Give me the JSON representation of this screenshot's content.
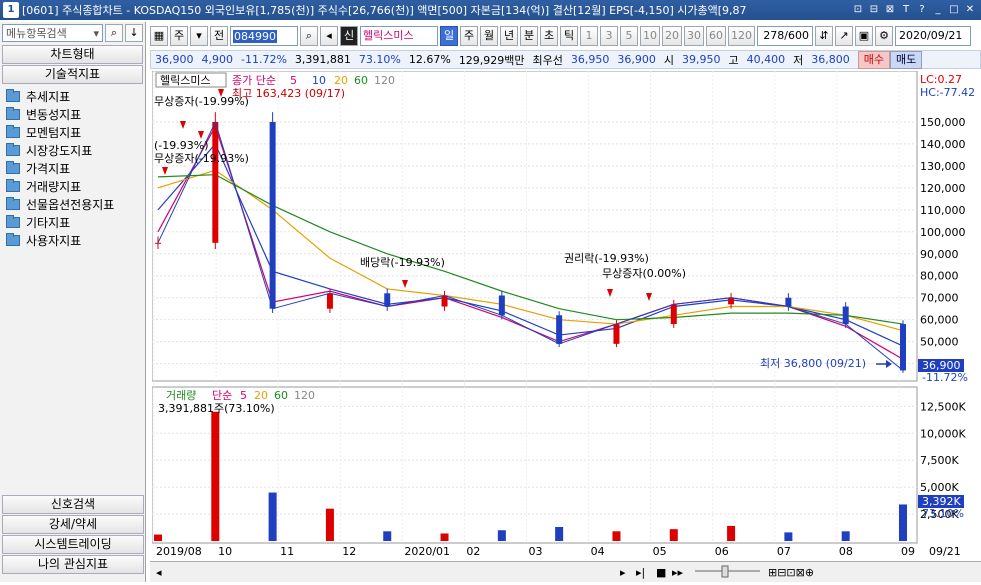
{
  "window": {
    "badge": "1",
    "title": "[0601] 주식종합차트 - KOSDAQ150 외국인보유[1,785(천)] 주식수[26,766(천)] 액면[500] 자본금[134(억)] 결산[12월] EPS[-4,150] 시가총액[9,87",
    "buttons": [
      "⊡",
      "⊟",
      "⊠",
      "T",
      "?",
      "_",
      "□",
      "✕"
    ]
  },
  "left": {
    "search_placeholder": "메뉴항목검색",
    "tabs": [
      "차트형태",
      "기술적지표"
    ],
    "tree": [
      "추세지표",
      "변동성지표",
      "모멘텀지표",
      "시장강도지표",
      "가격지표",
      "거래량지표",
      "선물옵션전용지표",
      "기타지표",
      "사용자지표"
    ],
    "bottom_buttons": [
      "신호검색",
      "강세/약세",
      "시스템트레이딩",
      "나의 관심지표"
    ]
  },
  "toolbar": {
    "type": "주",
    "prefix": "전",
    "code": "084990",
    "stock_badge": "신",
    "stock_name": "헬릭스미스",
    "periods": [
      "일",
      "주",
      "월",
      "년",
      "분",
      "초",
      "틱"
    ],
    "selected_period": "일",
    "intervals": [
      "1",
      "3",
      "5",
      "10",
      "20",
      "30",
      "60",
      "120"
    ],
    "count": "278/600",
    "date": "2020/09/21"
  },
  "info": {
    "price": "36,900",
    "change": "4,900",
    "change_pct": "-11.72%",
    "volume": "3,391,881",
    "vol_ratio": "73.10%",
    "turnover": "12.67%",
    "amount": "129,929백만",
    "best_label": "최우선",
    "ask": "36,950",
    "bid": "36,900",
    "open_label": "시",
    "open": "39,950",
    "high_label": "고",
    "high": "40,400",
    "low_label": "저",
    "low": "36,800",
    "buy": "매수",
    "sell": "매도"
  },
  "price_panel": {
    "stock": "헬릭스미스",
    "legend_ma": "종가 단순",
    "ma_periods": [
      "5",
      "10",
      "20",
      "60",
      "120"
    ],
    "ma_colors": [
      "#d6006c",
      "#1f3fbf",
      "#e6a000",
      "#1f8a1f",
      "#888888"
    ],
    "lc": "LC:0.27",
    "hc": "HC:-77.42",
    "yticks": [
      "150,000",
      "140,000",
      "130,000",
      "120,000",
      "110,000",
      "100,000",
      "90,000",
      "80,000",
      "70,000",
      "60,000",
      "50,000",
      "40,000"
    ],
    "current_price_tag": "36,900",
    "current_pct": "-11.72%",
    "annotations": {
      "high": "최고 163,423 (09/17)",
      "low": "최저 36,800 (09/21)",
      "ex_div": "배당락(-19.93%)",
      "ex_right": "권리락(-19.93%)",
      "bonus_zero": "무상증자(0.00%)",
      "bonus1": "무상증자(-19.93%)",
      "bonus2": "무상증자(-19.99%)",
      "bonus3": "(-19.93%)"
    }
  },
  "volume_panel": {
    "legend": "거래량",
    "legend_ma": "단순",
    "ma_periods": [
      "5",
      "20",
      "60",
      "120"
    ],
    "value_label": "3,391,881주(73.10%)",
    "yticks": [
      "12,500K",
      "10,000K",
      "7,500K",
      "5,000K",
      "2,500K"
    ],
    "current_tag": "3,392K",
    "current_pct": "73.10%"
  },
  "xaxis": [
    "2019/08",
    "10",
    "11",
    "12",
    "2020/01",
    "02",
    "03",
    "04",
    "05",
    "06",
    "07",
    "08",
    "09",
    "09/21"
  ],
  "chart_data": [
    {
      "type": "candlestick",
      "title": "헬릭스미스",
      "ylim": [
        33000,
        165000
      ],
      "x": [
        "2019/08",
        "2019/09",
        "2019/10",
        "2019/11",
        "2019/12",
        "2020/01",
        "2020/02",
        "2020/03",
        "2020/04",
        "2020/05",
        "2020/06",
        "2020/07",
        "2020/08",
        "2020/09/21"
      ],
      "series": [
        {
          "name": "종가",
          "values": [
            95000,
            150000,
            65000,
            72000,
            66000,
            71000,
            62000,
            49000,
            58000,
            67000,
            70000,
            66000,
            58000,
            36900
          ]
        },
        {
          "name": "5",
          "values": [
            100000,
            148000,
            68000,
            73000,
            66000,
            70000,
            61000,
            50000,
            58000,
            67000,
            70000,
            66000,
            57000,
            42000
          ]
        },
        {
          "name": "20",
          "values": [
            110000,
            140000,
            82000,
            74000,
            67000,
            70000,
            64000,
            53000,
            56000,
            66000,
            69000,
            66000,
            60000,
            48000
          ]
        },
        {
          "name": "60",
          "values": [
            120000,
            128000,
            110000,
            88000,
            74000,
            71000,
            67000,
            60000,
            58000,
            62000,
            66000,
            66000,
            62000,
            55000
          ]
        },
        {
          "name": "120",
          "values": [
            125000,
            126000,
            112000,
            100000,
            90000,
            82000,
            73000,
            65000,
            60000,
            61000,
            63000,
            63000,
            62000,
            58000
          ]
        }
      ],
      "high": 163423,
      "high_date": "09/17",
      "low": 36800,
      "low_date": "09/21"
    },
    {
      "type": "bar",
      "title": "거래량",
      "ylim": [
        0,
        13000000
      ],
      "x": [
        "2019/08",
        "2019/09",
        "2019/10",
        "2019/11",
        "2019/12",
        "2020/01",
        "2020/02",
        "2020/03",
        "2020/04",
        "2020/05",
        "2020/06",
        "2020/07",
        "2020/08",
        "2020/09/21"
      ],
      "values": [
        600000,
        12000000,
        4500000,
        3000000,
        900000,
        700000,
        1000000,
        1300000,
        900000,
        1100000,
        1400000,
        800000,
        900000,
        3391881
      ]
    }
  ]
}
